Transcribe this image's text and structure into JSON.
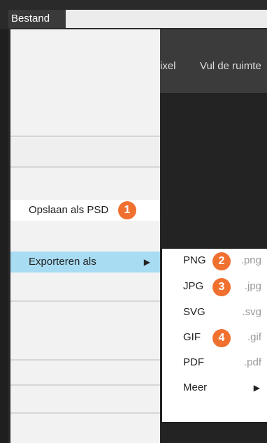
{
  "menubar": {
    "title": "Bestand"
  },
  "toolbar": {
    "tool1": "ixel",
    "tool2": "Vul de ruimte"
  },
  "menu": {
    "save_psd": "Opslaan als PSD",
    "export_as": "Exporteren als",
    "export_arrow": "▶"
  },
  "badges": [
    "1",
    "2",
    "3",
    "4"
  ],
  "submenu": {
    "items": [
      {
        "label": "PNG",
        "ext": ".png"
      },
      {
        "label": "JPG",
        "ext": ".jpg"
      },
      {
        "label": "SVG",
        "ext": ".svg"
      },
      {
        "label": "GIF",
        "ext": ".gif"
      },
      {
        "label": "PDF",
        "ext": ".pdf"
      },
      {
        "label": "Meer",
        "arrow": "▶"
      }
    ]
  },
  "colors": {
    "badge": "#f0702f",
    "highlight": "#a8dcf2",
    "menu_bg": "#f2f2f2",
    "dark_bg": "#1f1f1f"
  }
}
